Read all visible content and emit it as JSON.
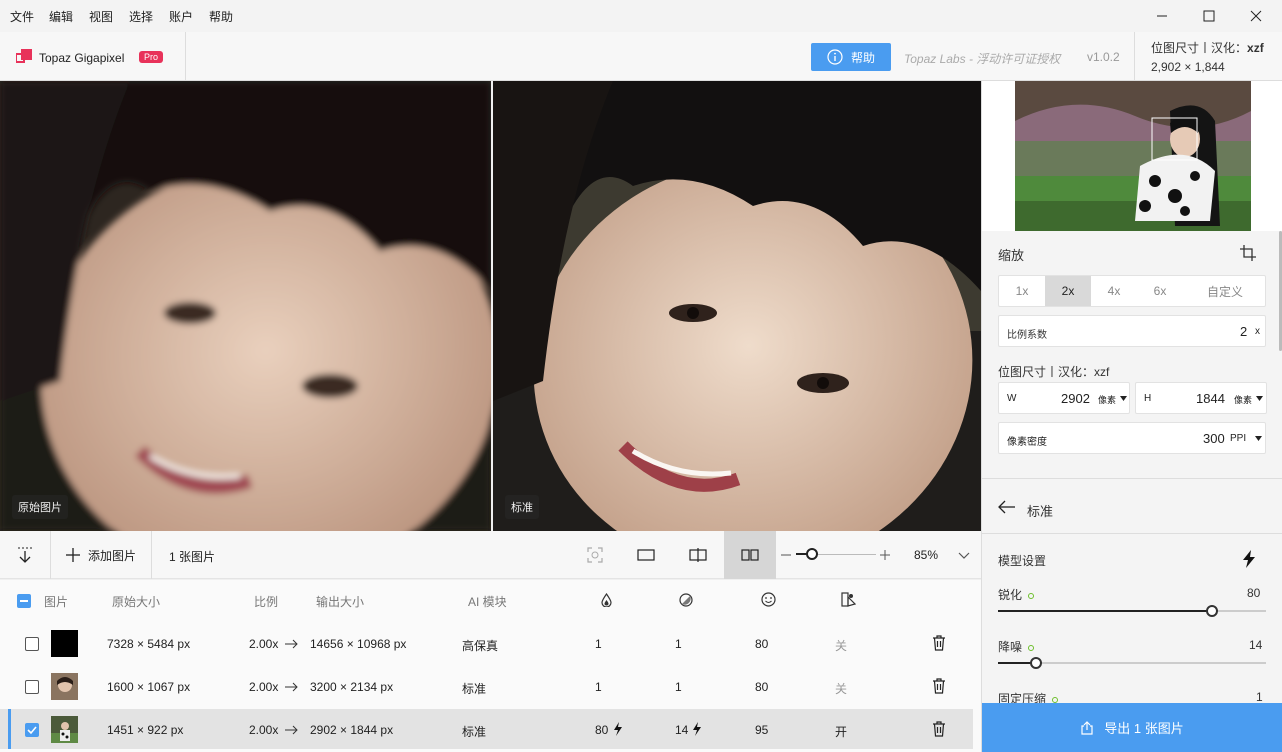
{
  "menu": [
    "文件",
    "编辑",
    "视图",
    "选择",
    "账户",
    "帮助"
  ],
  "header": {
    "app_name": "Topaz Gigapixel",
    "badge": "Pro",
    "help_label": "帮助",
    "license": "Topaz Labs - 浮动许可证授权",
    "version": "v1.0.2",
    "dims_title_prefix": "位图尺寸丨汉化：",
    "dims_title_name": "xzf",
    "dims_value": "2,902 × 1,844"
  },
  "panels": {
    "left_label": "原始图片",
    "right_label": "标准"
  },
  "toolbar": {
    "add_label": "添加图片",
    "count_label": "1 张图片",
    "zoom": "85%",
    "zoom_level": 0.2
  },
  "table": {
    "headers": {
      "image": "图片",
      "orig": "原始大小",
      "ratio": "比例",
      "out": "输出大小",
      "ai": "AI 模块"
    },
    "rows": [
      {
        "checked": false,
        "orig": "7328 × 5484 px",
        "ratio": "2.00x",
        "out": "14656 × 10968 px",
        "ai": "高保真",
        "sharpen": "1",
        "noise": "1",
        "face": "80",
        "face_switch": "关",
        "selected": false,
        "lightning": false
      },
      {
        "checked": false,
        "orig": "1600 × 1067 px",
        "ratio": "2.00x",
        "out": "3200 × 2134 px",
        "ai": "标准",
        "sharpen": "1",
        "noise": "1",
        "face": "80",
        "face_switch": "关",
        "selected": false,
        "lightning": false
      },
      {
        "checked": true,
        "orig": "1451 × 922 px",
        "ratio": "2.00x",
        "out": "2902 × 1844 px",
        "ai": "标准",
        "sharpen": "80",
        "noise": "14",
        "face": "95",
        "face_switch": "开",
        "selected": true,
        "lightning": true
      }
    ]
  },
  "right": {
    "zoom_title": "缩放",
    "scale_options": [
      "1x",
      "2x",
      "4x",
      "6x",
      "自定义"
    ],
    "scale_selected": "2x",
    "ratio_label": "比例系数",
    "ratio_value": "2",
    "ratio_unit": "x",
    "dims_label": "位图尺寸丨汉化：xzf",
    "w_label": "W",
    "w_value": "2902",
    "w_unit": "像素",
    "h_label": "H",
    "h_value": "1844",
    "h_unit": "像素",
    "ppi_label": "像素密度",
    "ppi_value": "300",
    "ppi_unit": "PPI",
    "model_back_title": "标准",
    "model_settings": "模型设置",
    "sharpen_label": "锐化",
    "sharpen_value": "80",
    "sharpen_level": 0.8,
    "denoise_label": "降噪",
    "denoise_value": "14",
    "denoise_level": 0.14,
    "compress_label": "固定压缩",
    "compress_value": "1",
    "export_label": "导出 1 张图片"
  },
  "colors": {
    "accent": "#4a9cf0",
    "pro": "#e8325a",
    "selected_row": "#e3e3e3"
  }
}
